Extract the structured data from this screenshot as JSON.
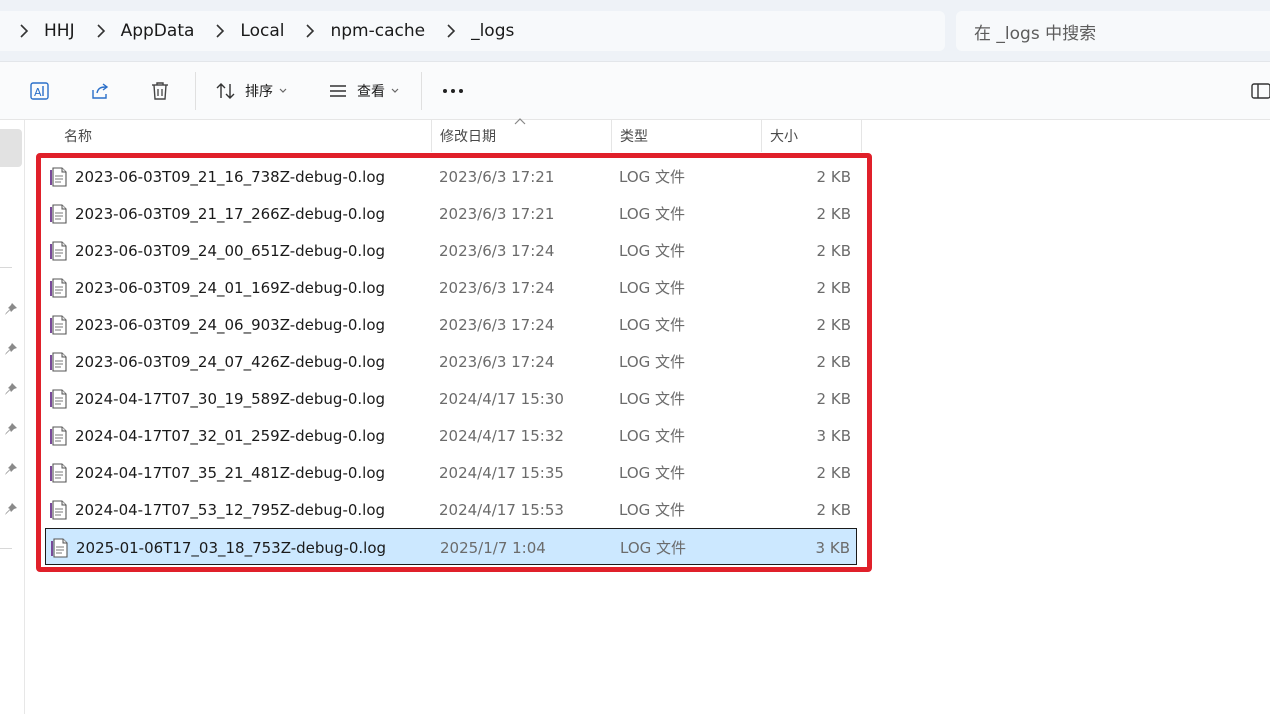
{
  "breadcrumb": {
    "items": [
      "HHJ",
      "AppData",
      "Local",
      "npm-cache",
      "_logs"
    ]
  },
  "search": {
    "placeholder": "在 _logs 中搜索"
  },
  "toolbar": {
    "sort_label": "排序",
    "view_label": "查看",
    "more_label": "···"
  },
  "columns": {
    "name": "名称",
    "date": "修改日期",
    "type": "类型",
    "size": "大小"
  },
  "files": [
    {
      "name": "2023-06-03T09_21_16_738Z-debug-0.log",
      "date": "2023/6/3 17:21",
      "type": "LOG 文件",
      "size": "2 KB"
    },
    {
      "name": "2023-06-03T09_21_17_266Z-debug-0.log",
      "date": "2023/6/3 17:21",
      "type": "LOG 文件",
      "size": "2 KB"
    },
    {
      "name": "2023-06-03T09_24_00_651Z-debug-0.log",
      "date": "2023/6/3 17:24",
      "type": "LOG 文件",
      "size": "2 KB"
    },
    {
      "name": "2023-06-03T09_24_01_169Z-debug-0.log",
      "date": "2023/6/3 17:24",
      "type": "LOG 文件",
      "size": "2 KB"
    },
    {
      "name": "2023-06-03T09_24_06_903Z-debug-0.log",
      "date": "2023/6/3 17:24",
      "type": "LOG 文件",
      "size": "2 KB"
    },
    {
      "name": "2023-06-03T09_24_07_426Z-debug-0.log",
      "date": "2023/6/3 17:24",
      "type": "LOG 文件",
      "size": "2 KB"
    },
    {
      "name": "2024-04-17T07_30_19_589Z-debug-0.log",
      "date": "2024/4/17 15:30",
      "type": "LOG 文件",
      "size": "2 KB"
    },
    {
      "name": "2024-04-17T07_32_01_259Z-debug-0.log",
      "date": "2024/4/17 15:32",
      "type": "LOG 文件",
      "size": "3 KB"
    },
    {
      "name": "2024-04-17T07_35_21_481Z-debug-0.log",
      "date": "2024/4/17 15:35",
      "type": "LOG 文件",
      "size": "2 KB"
    },
    {
      "name": "2024-04-17T07_53_12_795Z-debug-0.log",
      "date": "2024/4/17 15:53",
      "type": "LOG 文件",
      "size": "2 KB"
    },
    {
      "name": "2025-01-06T17_03_18_753Z-debug-0.log",
      "date": "2025/1/7 1:04",
      "type": "LOG 文件",
      "size": "3 KB",
      "selected": true
    }
  ],
  "colors": {
    "selection": "#cce8ff",
    "highlight_box": "#e0202a",
    "address_bg": "#eef2f7"
  },
  "icons": [
    "chevron-right-icon",
    "rename-icon",
    "share-icon",
    "delete-icon",
    "sort-icon",
    "view-icon",
    "more-icon",
    "details-pane-icon",
    "pin-icon",
    "log-file-icon"
  ]
}
